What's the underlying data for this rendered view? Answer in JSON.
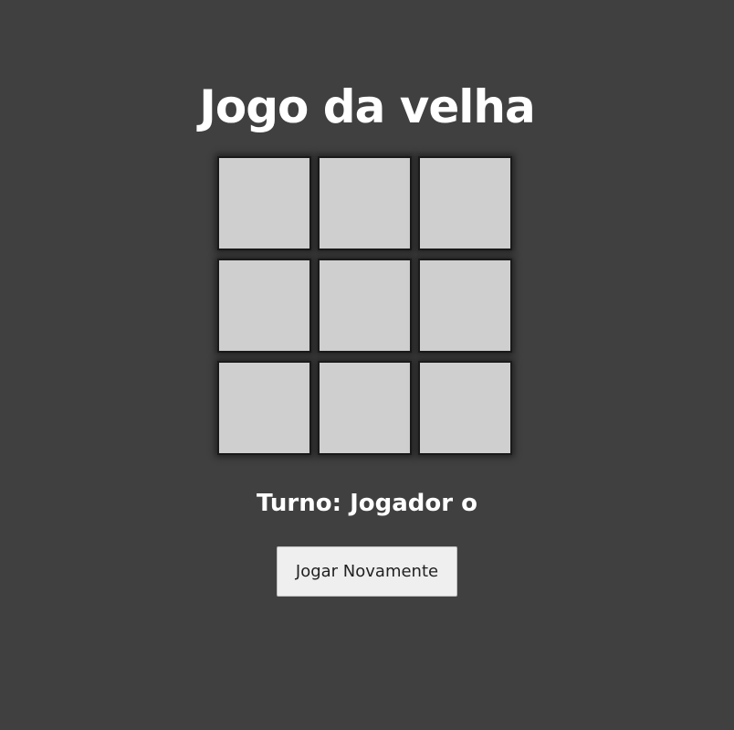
{
  "title": "Jogo da velha",
  "board": {
    "cells": [
      "",
      "",
      "",
      "",
      "",
      "",
      "",
      "",
      ""
    ]
  },
  "status": {
    "turn_text": "Turno: Jogador o"
  },
  "controls": {
    "replay_label": "Jogar Novamente"
  },
  "colors": {
    "background": "#404040",
    "cell": "#cfcfcf",
    "cell_border": "#1a1a1a",
    "text": "#ffffff",
    "button": "#efefef"
  }
}
